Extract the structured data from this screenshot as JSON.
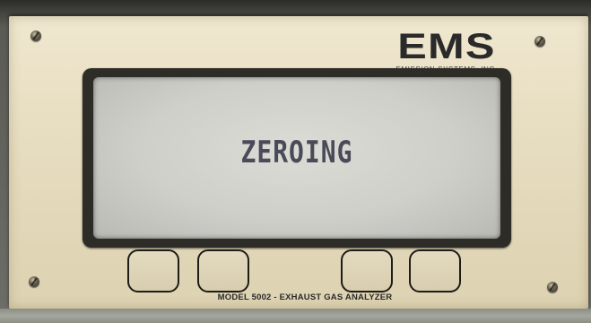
{
  "brand": {
    "logo_text": "EMS",
    "subtitle": "EMISSION SYSTEMS, INC."
  },
  "display": {
    "text": "ZEROING"
  },
  "buttons": [
    {
      "name": "soft-key-1"
    },
    {
      "name": "soft-key-2"
    },
    {
      "name": "soft-key-3"
    },
    {
      "name": "soft-key-4"
    }
  ],
  "model_label": "MODEL 5002 - EXHAUST GAS ANALYZER",
  "colors": {
    "panel": "#e6dcbf",
    "screen": "#d4d4cf",
    "display_text": "#4a4a58",
    "bezel": "#2e2c27"
  }
}
